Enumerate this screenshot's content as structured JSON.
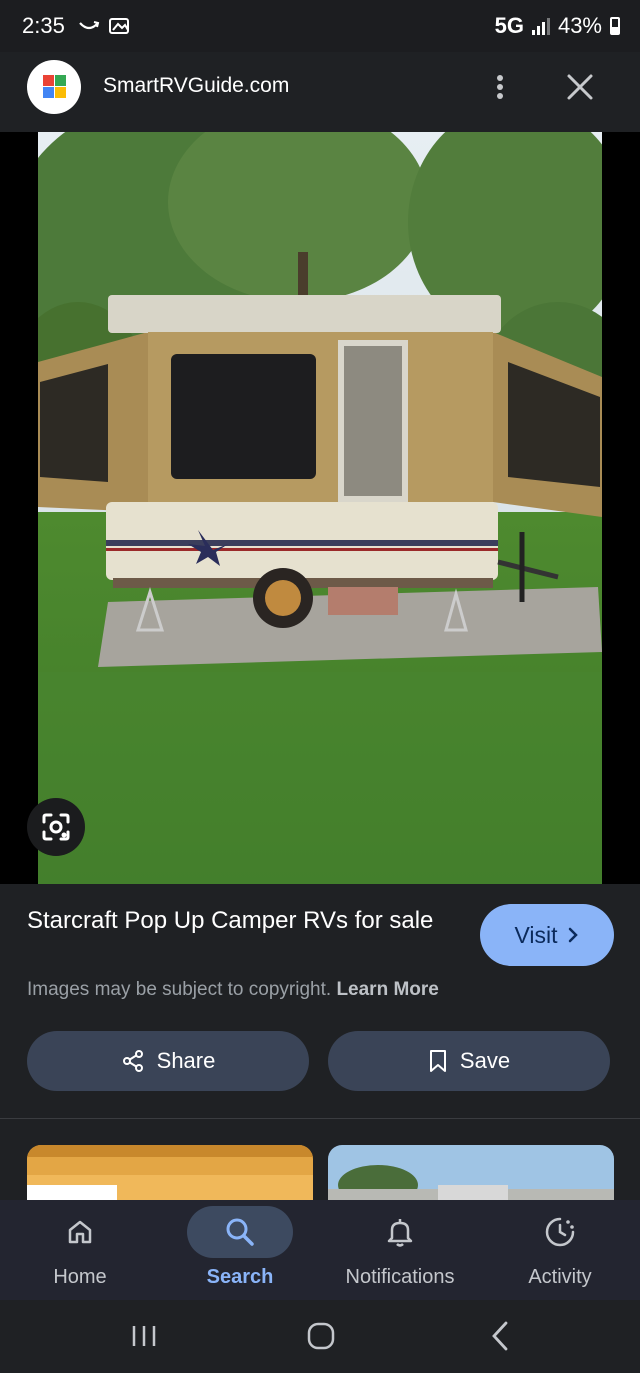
{
  "status_bar": {
    "time": "2:35",
    "network": "5G",
    "battery": "43%"
  },
  "header": {
    "site_name": "SmartRVGuide.com"
  },
  "result": {
    "title": "Starcraft Pop Up Camper RVs for sale",
    "visit_label": "Visit",
    "copyright_text": "Images may be subject to copyright.",
    "learn_more": "Learn More",
    "share_label": "Share",
    "save_label": "Save"
  },
  "bottom_nav": [
    {
      "label": "Home",
      "icon": "home-icon"
    },
    {
      "label": "Search",
      "icon": "search-icon",
      "active": true
    },
    {
      "label": "Notifications",
      "icon": "bell-icon"
    },
    {
      "label": "Activity",
      "icon": "activity-icon"
    }
  ],
  "colors": {
    "accent": "#8ab4f8",
    "background": "#1f2124",
    "pill": "#3a4457"
  }
}
